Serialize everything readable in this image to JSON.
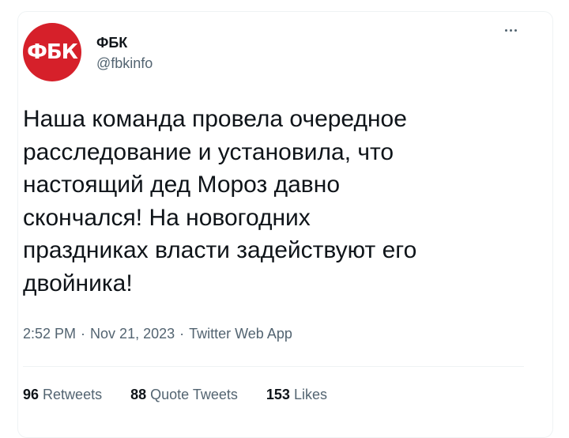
{
  "tweet": {
    "author": {
      "avatar_text": "ФБК",
      "name": "ФБК",
      "handle": "@fbkinfo"
    },
    "text": "Наша команда провела очередное\nрасследование и установила, что\nнастоящий дед Мороз давно\nскончался! На новогодних\nпраздниках власти задействуют его\nдвойника!",
    "meta": {
      "time": "2:52 PM",
      "separator": "·",
      "date": "Nov 21, 2023",
      "source": "Twitter Web App"
    },
    "stats": [
      {
        "count": "96",
        "label": "Retweets"
      },
      {
        "count": "88",
        "label": "Quote Tweets"
      },
      {
        "count": "153",
        "label": "Likes"
      }
    ]
  },
  "colors": {
    "avatar_bg": "#d6202a",
    "text_primary": "#0f1419",
    "text_secondary": "#536471",
    "divider": "#eff3f4"
  },
  "icons": {
    "more": "more-dots-icon"
  }
}
